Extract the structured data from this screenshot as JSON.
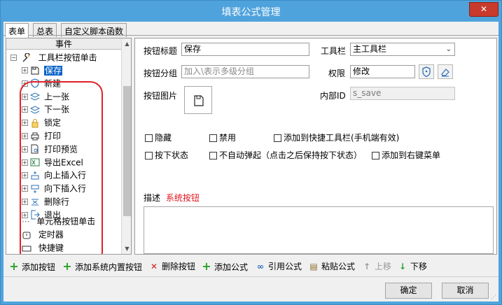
{
  "window": {
    "title": "填表公式管理",
    "close_label": "✕"
  },
  "tabs": [
    {
      "label": "表单",
      "active": true
    },
    {
      "label": "总表",
      "active": false
    },
    {
      "label": "自定义脚本函数",
      "active": false
    }
  ],
  "tree": {
    "header": "事件",
    "root_label": "工具栏按钮单击",
    "items": [
      {
        "label": "保存",
        "icon": "save-icon",
        "selected": true
      },
      {
        "label": "新建",
        "icon": "shield-icon"
      },
      {
        "label": "上一张",
        "icon": "layers-icon"
      },
      {
        "label": "下一张",
        "icon": "layers-icon"
      },
      {
        "label": "锁定",
        "icon": "lock-icon"
      },
      {
        "label": "打印",
        "icon": "printer-icon"
      },
      {
        "label": "打印预览",
        "icon": "print-preview-icon"
      },
      {
        "label": "导出Excel",
        "icon": "excel-icon"
      },
      {
        "label": "向上插入行",
        "icon": "insert-row-above-icon"
      },
      {
        "label": "向下插入行",
        "icon": "insert-row-below-icon"
      },
      {
        "label": "删除行",
        "icon": "delete-row-icon"
      },
      {
        "label": "退出",
        "icon": "exit-icon"
      }
    ],
    "other_items": [
      {
        "label": "单元格按钮单击"
      },
      {
        "label": "定时器"
      },
      {
        "label": "快捷键"
      }
    ]
  },
  "form": {
    "button_title_label": "按钮标题",
    "button_title_value": "保存",
    "toolbar_label": "工具栏",
    "toolbar_value": "主工具栏",
    "group_label": "按钮分组",
    "group_placeholder": "加入\\表示多级分组",
    "permission_label": "权限",
    "permission_value": "修改",
    "image_label": "按钮图片",
    "internal_id_label": "内部ID",
    "internal_id_value": "s_save",
    "checkboxes": [
      {
        "label": "隐藏",
        "checked": false
      },
      {
        "label": "禁用",
        "checked": false
      },
      {
        "label": "添加到快捷工具栏(手机端有效)",
        "checked": false
      },
      {
        "label": "按下状态",
        "checked": false
      },
      {
        "label": "不自动弹起（点击之后保持按下状态）",
        "checked": false
      },
      {
        "label": "添加到右键菜单",
        "checked": false
      }
    ],
    "desc_label": "描述",
    "desc_value": "系统按钮"
  },
  "toolbar": {
    "add_button": "添加按钮",
    "add_system_button": "添加系统内置按钮",
    "delete_button": "删除按钮",
    "add_formula": "添加公式",
    "cite_formula": "引用公式",
    "paste_formula": "粘贴公式",
    "move_up": "上移",
    "move_down": "下移"
  },
  "dialog": {
    "ok": "确定",
    "cancel": "取消"
  },
  "colors": {
    "title_bar": "#4fa3dc",
    "close_button": "#c83a2c",
    "selection": "#0a64c8",
    "highlight": "#e0202a",
    "add_green": "#2aa22a",
    "delete_red": "#d81e1e"
  }
}
